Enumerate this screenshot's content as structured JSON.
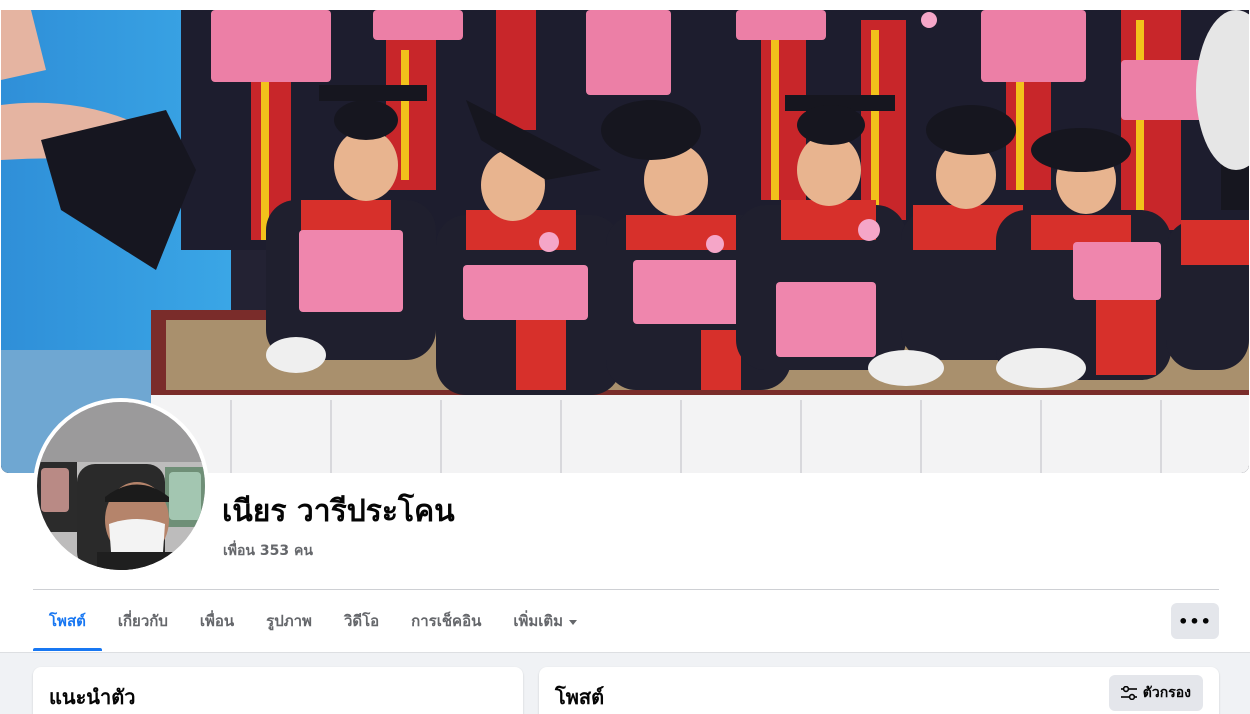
{
  "profile": {
    "name": "เนียร วารีประโคน",
    "friends": "เพื่อน 353 คน"
  },
  "tabs": [
    {
      "label": "โพสต์",
      "active": true
    },
    {
      "label": "เกี่ยวกับ"
    },
    {
      "label": "เพื่อน"
    },
    {
      "label": "รูปภาพ"
    },
    {
      "label": "วิดีโอ"
    },
    {
      "label": "การเช็คอิน"
    },
    {
      "label": "เพิ่มเติม"
    }
  ],
  "more_button": "•••",
  "intro": {
    "title": "แนะนำตัว"
  },
  "posts": {
    "title": "โพสต์",
    "filter_label": "ตัวกรอง"
  },
  "colors": {
    "accent": "#1877f2",
    "secondary_text": "#65676b",
    "button_bg": "#e4e6eb",
    "page_bg": "#f0f2f5"
  }
}
